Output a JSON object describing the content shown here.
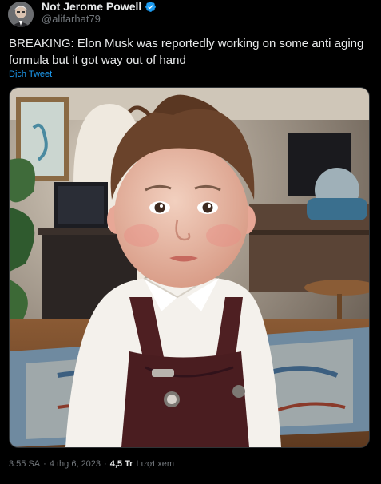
{
  "author": {
    "display_name": "Not Jerome Powell",
    "handle": "@alifarhat79",
    "verified_icon": "verified-badge-icon",
    "badge_color": "#1d9bf0"
  },
  "tweet": {
    "text": "BREAKING: Elon Musk was reportedly working on some anti aging formula but it got way out of hand",
    "translate_label": "Dịch Tweet"
  },
  "media": {
    "description_icon": "photo-icon"
  },
  "meta": {
    "time": "3:55 SA",
    "separator": "·",
    "date": "4 thg 6, 2023",
    "separator2": "·",
    "views_count": "4,5 Tr",
    "views_label": "Lượt xem"
  },
  "colors": {
    "background": "#000000",
    "text_primary": "#e7e9ea",
    "text_secondary": "#71767b",
    "link": "#1d9bf0"
  }
}
